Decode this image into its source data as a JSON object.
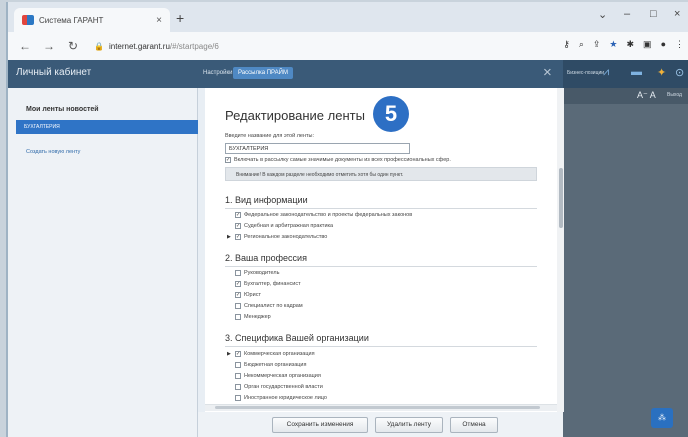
{
  "browser": {
    "tab_title": "Система ГАРАНТ",
    "tab_close": "×",
    "new_tab": "+",
    "url_host": "internet.garant.ru",
    "url_path": "/#/startpage/6",
    "win_min": "–",
    "win_max": "□",
    "win_close": "×",
    "win_chevron": "⌄"
  },
  "app": {
    "title": "Личный кабинет",
    "tabs": [
      "Настройки",
      "Рассылка ПРАЙМ"
    ],
    "close": "×",
    "right_text": "Бизнес-позиции",
    "font_control": "A⁻ A",
    "exit": "Выход",
    "chat_button": "⁂"
  },
  "sidebar": {
    "heading": "Мои ленты новостей",
    "active_item": "БУХГАЛТЕРИЯ",
    "create_link": "Создать новую ленту"
  },
  "dialog": {
    "title": "Редактирование ленты",
    "step_badge": "5",
    "name_label": "Введите название для этой ленты:",
    "name_value": "БУХГАЛТЕРИЯ",
    "include_checkbox": {
      "label": "Включать в рассылку самые значимые документы из всех профессиональных сфер.",
      "checked": true
    },
    "notice": "Внимание! В каждом разделе необходимо отметить хотя бы один пункт.",
    "sections": [
      {
        "title": "1. Вид информации",
        "items": [
          {
            "label": "Федеральное законодательство и проекты федеральных законов",
            "checked": true
          },
          {
            "label": "Судебная и арбитражная практика",
            "checked": true
          },
          {
            "label": "Региональное законодательство",
            "checked": true
          }
        ]
      },
      {
        "title": "2. Ваша профессия",
        "items": [
          {
            "label": "Руководитель",
            "checked": false
          },
          {
            "label": "Бухгалтер, финансист",
            "checked": true
          },
          {
            "label": "Юрист",
            "checked": true
          },
          {
            "label": "Специалист по кадрам",
            "checked": false
          },
          {
            "label": "Менеджер",
            "checked": false
          }
        ]
      },
      {
        "title": "3. Специфика Вашей организации",
        "items": [
          {
            "label": "Коммерческая организация",
            "checked": true
          },
          {
            "label": "Бюджетная организация",
            "checked": false
          },
          {
            "label": "Некоммерческая организация",
            "checked": false
          },
          {
            "label": "Орган государственной власти",
            "checked": false
          },
          {
            "label": "Иностранное юридическое лицо",
            "checked": false
          }
        ]
      }
    ]
  },
  "footer": {
    "save": "Сохранить изменения",
    "delete": "Удалить ленту",
    "cancel": "Отмена"
  }
}
